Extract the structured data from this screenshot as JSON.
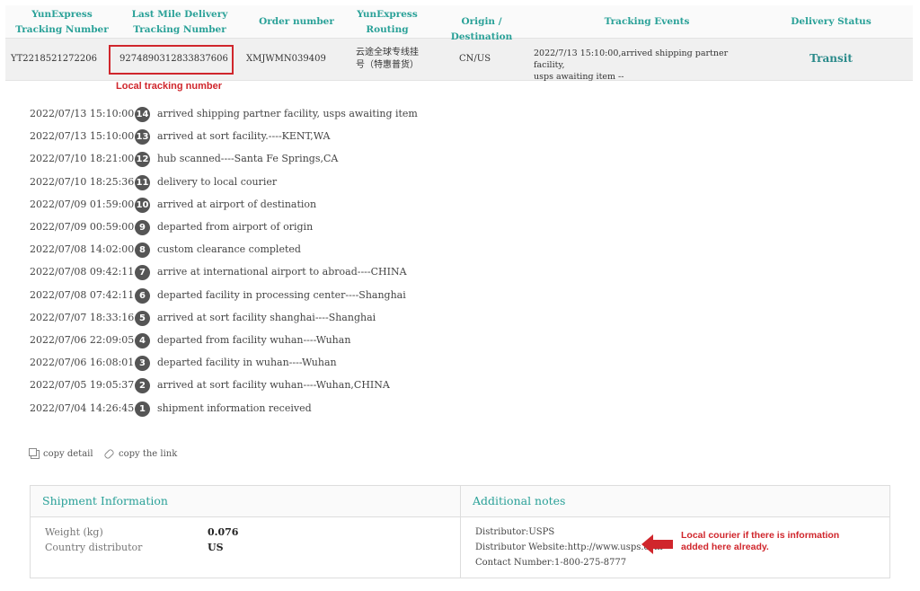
{
  "table": {
    "headers": [
      {
        "line1": "YunExpress",
        "line2": "Tracking Number"
      },
      {
        "line1": "Last Mile Delivery",
        "line2": "Tracking Number"
      },
      {
        "line1": "Order number",
        "line2": ""
      },
      {
        "line1": "YunExpress",
        "line2": "Routing"
      },
      {
        "line1": "Origin / Destination",
        "line2": ""
      },
      {
        "line1": "Tracking Events",
        "line2": ""
      },
      {
        "line1": "Delivery Status",
        "line2": ""
      }
    ],
    "row": {
      "tracking_number": "YT2218521272206",
      "last_mile_number": "9274890312833837606",
      "order_number": "XMJWMN039409",
      "routing_line1": "云途全球专线挂",
      "routing_line2": "号（特惠普货）",
      "origin_destination": "CN/US",
      "event_line1": "2022/7/13 15:10:00,arrived shipping partner facility,",
      "event_line2": "usps awaiting item --",
      "status": "Transit"
    }
  },
  "annotations": {
    "local_tracking": "Local tracking number",
    "local_courier_line1": "Local courier if there is information",
    "local_courier_line2": "added here already.",
    "highlight_color": "#d0262c"
  },
  "events": [
    {
      "time": "2022/07/13 15:10:00",
      "num": "14",
      "desc": "arrived shipping partner facility, usps awaiting item"
    },
    {
      "time": "2022/07/13 15:10:00",
      "num": "13",
      "desc": "arrived at sort facility.----KENT,WA"
    },
    {
      "time": "2022/07/10 18:21:00",
      "num": "12",
      "desc": "hub scanned----Santa Fe Springs,CA"
    },
    {
      "time": "2022/07/10 18:25:36",
      "num": "11",
      "desc": "delivery to local courier"
    },
    {
      "time": "2022/07/09 01:59:00",
      "num": "10",
      "desc": "arrived at airport of destination"
    },
    {
      "time": "2022/07/09 00:59:00",
      "num": "9",
      "desc": "departed from airport of origin"
    },
    {
      "time": "2022/07/08 14:02:00",
      "num": "8",
      "desc": "custom clearance completed"
    },
    {
      "time": "2022/07/08 09:42:11",
      "num": "7",
      "desc": "arrive at international airport to abroad----CHINA"
    },
    {
      "time": "2022/07/08 07:42:11",
      "num": "6",
      "desc": "departed facility in processing center----Shanghai"
    },
    {
      "time": "2022/07/07 18:33:16",
      "num": "5",
      "desc": "arrived at sort facility shanghai----Shanghai"
    },
    {
      "time": "2022/07/06 22:09:05",
      "num": "4",
      "desc": "departed from facility wuhan----Wuhan"
    },
    {
      "time": "2022/07/06 16:08:01",
      "num": "3",
      "desc": "departed facility in wuhan----Wuhan"
    },
    {
      "time": "2022/07/05 19:05:37",
      "num": "2",
      "desc": "arrived at sort facility wuhan----Wuhan,CHINA"
    },
    {
      "time": "2022/07/04 14:26:45",
      "num": "1",
      "desc": "shipment information received"
    }
  ],
  "actions": {
    "copy_detail": "copy detail",
    "copy_link": "copy the link"
  },
  "shipment": {
    "title": "Shipment Information",
    "weight_label": "Weight (kg)",
    "weight_value": "0.076",
    "distributor_label": "Country distributor",
    "distributor_value": "US"
  },
  "notes": {
    "title": "Additional notes",
    "distributor": "Distributor:USPS",
    "website": "Distributor Website:http://www.usps.com",
    "contact": "Contact Number:1-800-275-8777"
  },
  "colors": {
    "accent": "#2aa198",
    "badge": "#555555"
  }
}
